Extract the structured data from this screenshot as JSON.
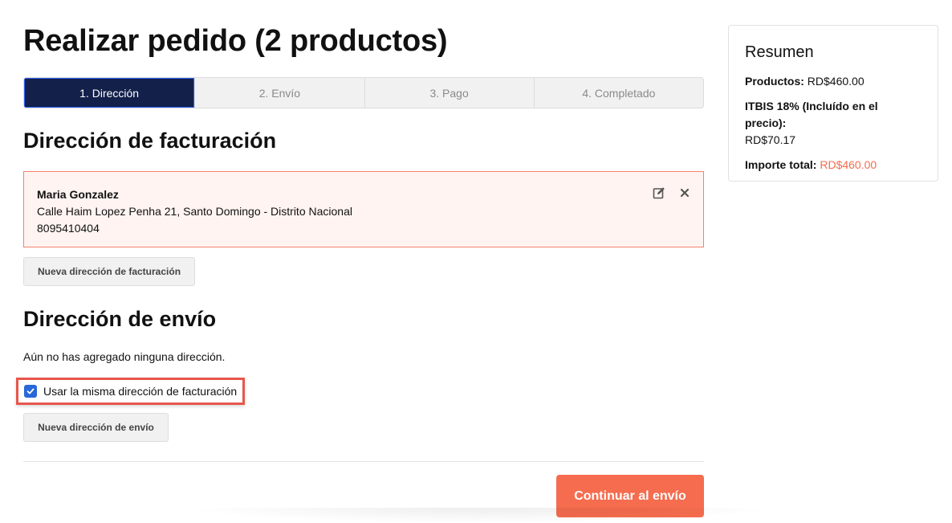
{
  "page": {
    "title": "Realizar pedido (2 productos)"
  },
  "steps": [
    {
      "label": "1. Dirección",
      "active": true
    },
    {
      "label": "2. Envío",
      "active": false
    },
    {
      "label": "3. Pago",
      "active": false
    },
    {
      "label": "4. Completado",
      "active": false
    }
  ],
  "billing": {
    "title": "Dirección de facturación",
    "address": {
      "name": "Maria Gonzalez",
      "street": "Calle Haim Lopez Penha 21, Santo Domingo - Distrito Nacional",
      "phone": "8095410404"
    },
    "new_button": "Nueva dirección de facturación"
  },
  "shipping": {
    "title": "Dirección de envío",
    "empty_message": "Aún no has agregado ninguna dirección.",
    "same_address_label": "Usar la misma dirección de facturación",
    "same_address_checked": true,
    "new_button": "Nueva dirección de envío"
  },
  "continue_button": "Continuar al envío",
  "summary": {
    "title": "Resumen",
    "products_label": "Productos:",
    "products_value": "RD$460.00",
    "tax_label": "ITBIS 18% (Incluído en el precio):",
    "tax_value": "RD$70.17",
    "total_label": "Importe total:",
    "total_value": "RD$460.00"
  },
  "icons": {
    "edit": "edit-icon",
    "close": "close-icon",
    "check": "check-icon"
  },
  "colors": {
    "accent": "#f56c4e",
    "active_step": "#12204a",
    "checkbox": "#2868d8",
    "highlight_border": "#e8564c"
  }
}
